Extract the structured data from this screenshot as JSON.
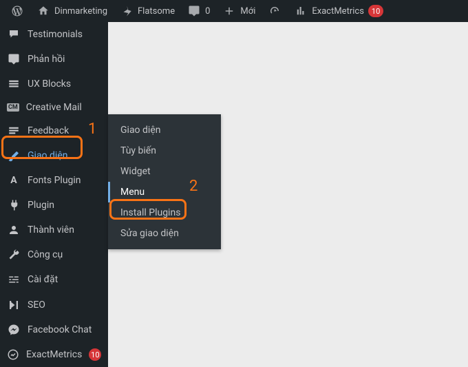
{
  "topbar": {
    "site_name": "Dinmarketing",
    "theme": "Flatsome",
    "comments_count": "0",
    "new_label": "Mới",
    "analytics": "ExactMetrics",
    "analytics_badge": "10"
  },
  "sidebar": {
    "testimonials": "Testimonials",
    "feedback1": "Phản hồi",
    "ux_blocks": "UX Blocks",
    "creative_mail": "Creative Mail",
    "cm_badge": "CM",
    "feedback2": "Feedback",
    "appearance": "Giao diện",
    "fonts_plugin": "Fonts Plugin",
    "plugin": "Plugin",
    "users": "Thành viên",
    "tools": "Công cụ",
    "settings": "Cài đặt",
    "seo": "SEO",
    "facebook_chat": "Facebook Chat",
    "exactmetrics": "ExactMetrics",
    "em_badge": "10"
  },
  "submenu": {
    "themes": "Giao diện",
    "customize": "Tùy biến",
    "widget": "Widget",
    "menu": "Menu",
    "install_plugins": "Install Plugins",
    "editor": "Sửa giao diện"
  },
  "annotations": {
    "num1": "1",
    "num2": "2"
  }
}
